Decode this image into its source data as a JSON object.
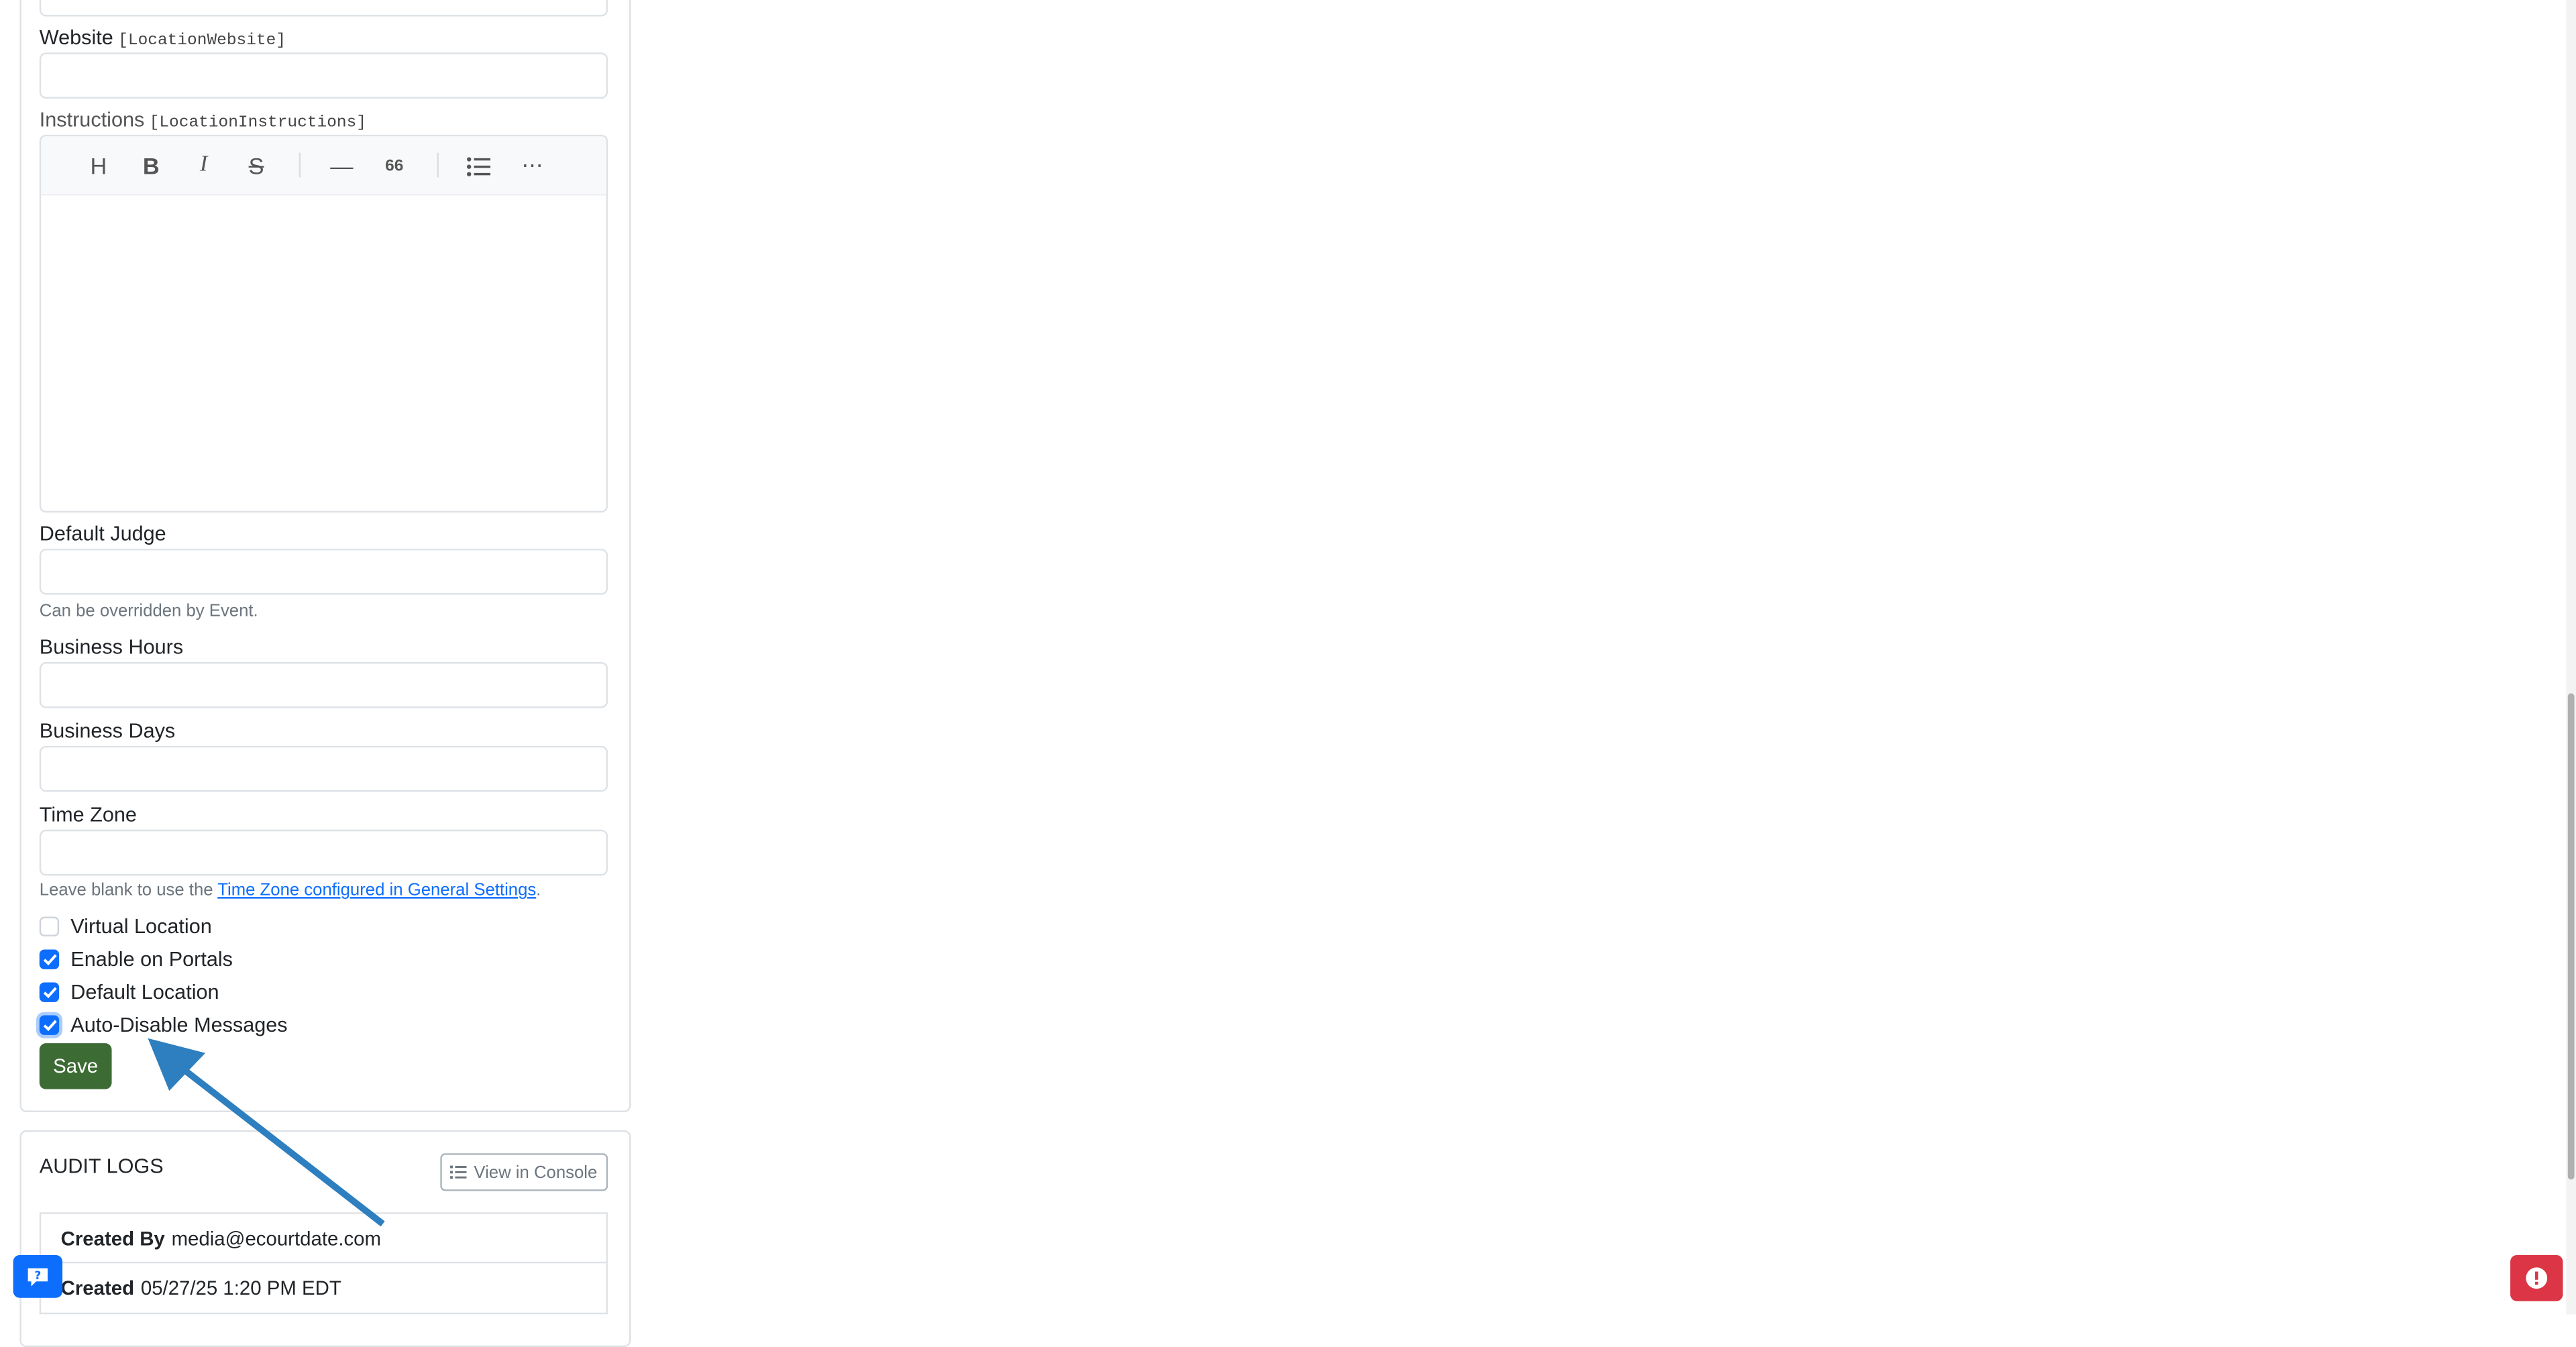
{
  "form": {
    "website_label": "Website",
    "website_token": "[LocationWebsite]",
    "instructions_label": "Instructions",
    "instructions_token": "[LocationInstructions]",
    "toolbar": {
      "heading": "H",
      "bold": "B",
      "italic": "I",
      "strike": "S",
      "hr": "—",
      "quote": "66",
      "more": "⋯"
    },
    "default_judge_label": "Default Judge",
    "default_judge_help": "Can be overridden by Event.",
    "business_hours_label": "Business Hours",
    "business_days_label": "Business Days",
    "time_zone_label": "Time Zone",
    "time_zone_help_prefix": "Leave blank to use the ",
    "time_zone_help_link": "Time Zone configured in General Settings",
    "time_zone_help_suffix": ".",
    "checkboxes": [
      {
        "label": "Virtual Location",
        "checked": false
      },
      {
        "label": "Enable on Portals",
        "checked": true
      },
      {
        "label": "Default Location",
        "checked": true
      },
      {
        "label": "Auto-Disable Messages",
        "checked": true
      }
    ],
    "save_label": "Save"
  },
  "audit": {
    "title": "AUDIT LOGS",
    "console_label": "View in Console",
    "created_by_label": "Created By",
    "created_by_value": "media@ecourtdate.com",
    "created_label": "Created",
    "created_value": "05/27/25 1:20 PM EDT"
  },
  "colors": {
    "primary": "#0d6efd",
    "save": "#3d6b34",
    "error": "#dc3545",
    "annotation_arrow": "#2e7fbf"
  }
}
